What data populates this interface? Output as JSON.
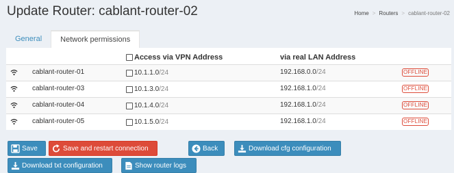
{
  "header": {
    "title": "Update Router: cablant-router-02"
  },
  "breadcrumb": {
    "items": [
      "Home",
      "Routers"
    ],
    "current": "cablant-router-02"
  },
  "tabs": [
    {
      "label": "General",
      "active": false
    },
    {
      "label": "Network permissions",
      "active": true
    }
  ],
  "table": {
    "vpn_header": "Access via VPN Address",
    "lan_header": "via real LAN Address",
    "rows": [
      {
        "name": "cablant-router-01",
        "vpn_ip": "10.1.1.0",
        "vpn_mask": "/24",
        "lan_ip": "192.168.0.0",
        "lan_mask": "/24",
        "status": "OFFLINE",
        "icon": "wifi-icon"
      },
      {
        "name": "cablant-router-03",
        "vpn_ip": "10.1.3.0",
        "vpn_mask": "/24",
        "lan_ip": "192.168.1.0",
        "lan_mask": "/24",
        "status": "OFFLINE",
        "icon": "wifi-icon"
      },
      {
        "name": "cablant-router-04",
        "vpn_ip": "10.1.4.0",
        "vpn_mask": "/24",
        "lan_ip": "192.168.1.0",
        "lan_mask": "/24",
        "status": "OFFLINE",
        "icon": "wifi-icon"
      },
      {
        "name": "cablant-router-05",
        "vpn_ip": "10.1.5.0",
        "vpn_mask": "/24",
        "lan_ip": "192.168.1.0",
        "lan_mask": "/24",
        "status": "OFFLINE",
        "icon": "wifi-icon"
      }
    ]
  },
  "actions": {
    "save": "Save",
    "save_restart": "Save and restart connection",
    "back": "Back",
    "download_cfg": "Download cfg configuration",
    "download_txt": "Download txt configuration",
    "show_logs": "Show router logs"
  },
  "colors": {
    "primary": "#3c8dbc",
    "danger": "#dd4b39",
    "background": "#ecf0f5"
  }
}
